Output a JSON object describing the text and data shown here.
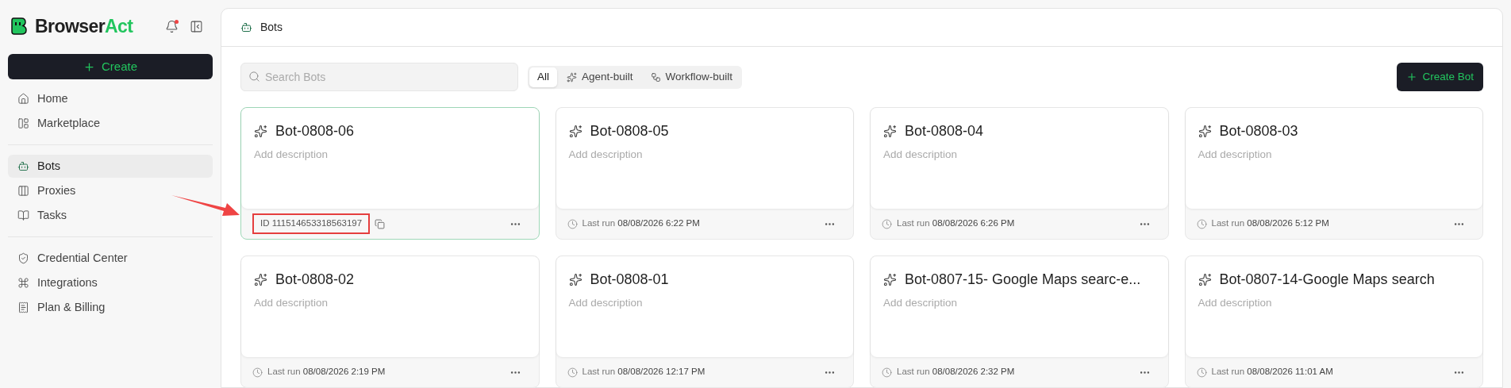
{
  "sidebar": {
    "brand": {
      "text": "Browser",
      "accent": "Act"
    },
    "notifications_unread": true,
    "create_button": "Create",
    "groups": [
      [
        {
          "label": "Home",
          "selected": false
        },
        {
          "label": "Marketplace",
          "selected": false
        }
      ],
      [
        {
          "label": "Bots",
          "selected": true
        },
        {
          "label": "Proxies",
          "selected": false
        },
        {
          "label": "Tasks",
          "selected": false
        }
      ],
      [
        {
          "label": "Credential Center",
          "selected": false
        },
        {
          "label": "Integrations",
          "selected": false
        },
        {
          "label": "Plan & Billing",
          "selected": false
        }
      ]
    ]
  },
  "header": {
    "title": "Bots"
  },
  "toolbar": {
    "search": {
      "placeholder": "Search Bots"
    },
    "filters": [
      {
        "label": "All",
        "selected": true,
        "kind": "all"
      },
      {
        "label": "Agent-built",
        "selected": false,
        "kind": "agent"
      },
      {
        "label": "Workflow-built",
        "selected": false,
        "kind": "workflow"
      }
    ],
    "create_button": "Create Bot"
  },
  "bots": [
    {
      "name": "Bot-0808-06",
      "description": "Add description",
      "selected": true,
      "footer": {
        "kind": "id",
        "label": "ID",
        "value": "111514653318563197"
      }
    },
    {
      "name": "Bot-0808-05",
      "description": "Add description",
      "selected": false,
      "footer": {
        "kind": "last_run",
        "label": "Last run",
        "value": "08/08/2026 6:22 PM"
      }
    },
    {
      "name": "Bot-0808-04",
      "description": "Add description",
      "selected": false,
      "footer": {
        "kind": "last_run",
        "label": "Last run",
        "value": "08/08/2026 6:26 PM"
      }
    },
    {
      "name": "Bot-0808-03",
      "description": "Add description",
      "selected": false,
      "footer": {
        "kind": "last_run",
        "label": "Last run",
        "value": "08/08/2026 5:12 PM"
      }
    },
    {
      "name": "Bot-0808-02",
      "description": "Add description",
      "selected": false,
      "footer": {
        "kind": "last_run",
        "label": "Last run",
        "value": "08/08/2026 2:19 PM"
      }
    },
    {
      "name": "Bot-0808-01",
      "description": "Add description",
      "selected": false,
      "footer": {
        "kind": "last_run",
        "label": "Last run",
        "value": "08/08/2026 12:17 PM"
      }
    },
    {
      "name": "Bot-0807-15- Google Maps searc-e...",
      "description": "Add description",
      "selected": false,
      "footer": {
        "kind": "last_run",
        "label": "Last run",
        "value": "08/08/2026 2:32 PM"
      }
    },
    {
      "name": "Bot-0807-14-Google Maps search",
      "description": "Add description",
      "selected": false,
      "footer": {
        "kind": "last_run",
        "label": "Last run",
        "value": "08/08/2026 11:01 AM"
      }
    }
  ]
}
